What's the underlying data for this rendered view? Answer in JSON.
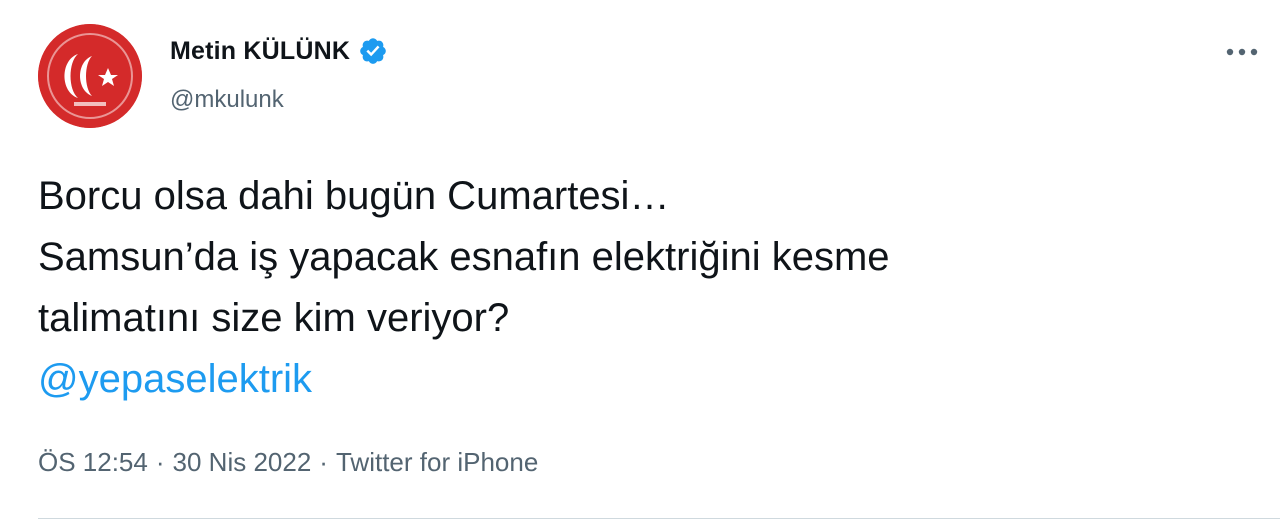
{
  "author": {
    "display_name": "Metin KÜLÜNK",
    "handle": "@mkulunk",
    "avatar_icon": "crescent-star-logo",
    "verified_icon": "verified-badge-icon",
    "avatar_color": "#d42a2a",
    "verified_color": "#1d9bf0"
  },
  "more_icon": "more-options-icon",
  "tweet": {
    "lines": [
      "Borcu olsa dahi bugün Cumartesi…",
      "Samsun’da iş yapacak esnafın elektriğini kesme",
      "talimatını size kim veriyor?"
    ],
    "mention": "@yepaselektrik"
  },
  "meta": {
    "time": "ÖS 12:54",
    "separator": "·",
    "date": "30 Nis 2022",
    "source": "Twitter for iPhone"
  },
  "colors": {
    "text": "#0f1419",
    "secondary": "#536471",
    "link": "#1d9bf0"
  }
}
